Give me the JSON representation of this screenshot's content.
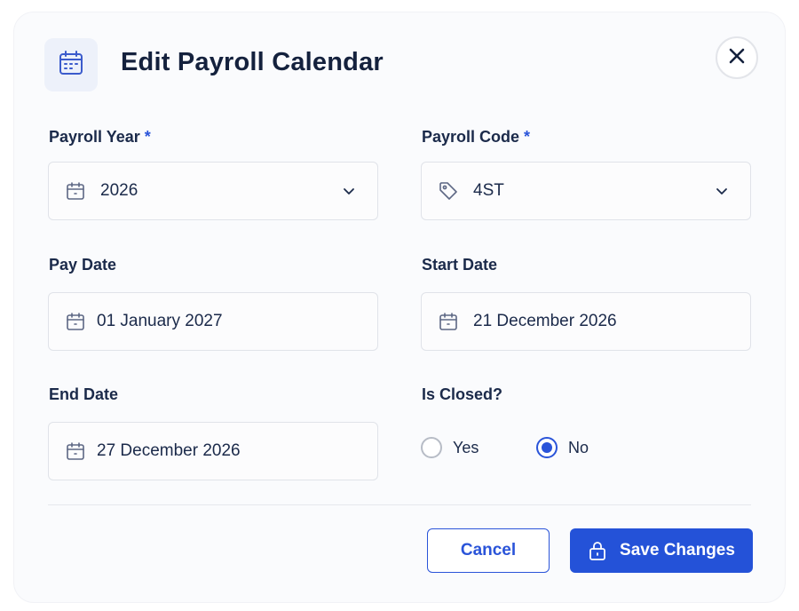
{
  "dialog": {
    "title": "Edit Payroll Calendar",
    "header_icon": "calendar-icon",
    "close_icon": "close-icon"
  },
  "fields": {
    "payroll_year": {
      "label": "Payroll Year",
      "required_mark": "*",
      "value": "2026",
      "icon": "calendar-icon"
    },
    "payroll_code": {
      "label": "Payroll Code",
      "required_mark": "*",
      "value": "4ST",
      "icon": "tag-icon"
    },
    "pay_date": {
      "label": "Pay Date",
      "value": "01 January 2027",
      "icon": "calendar-icon"
    },
    "start_date": {
      "label": "Start Date",
      "value": "21 December 2026",
      "icon": "calendar-icon"
    },
    "end_date": {
      "label": "End Date",
      "value": "27 December 2026",
      "icon": "calendar-icon"
    }
  },
  "is_closed": {
    "label": "Is Closed?",
    "options": [
      {
        "label": "Yes",
        "checked": false
      },
      {
        "label": "No",
        "checked": true
      }
    ]
  },
  "actions": {
    "cancel_label": "Cancel",
    "save_label": "Save Changes",
    "save_icon": "lock-icon"
  },
  "colors": {
    "accent": "#2a54d9",
    "title_text": "#14213d",
    "header_icon_bg": "#edf1fa"
  }
}
